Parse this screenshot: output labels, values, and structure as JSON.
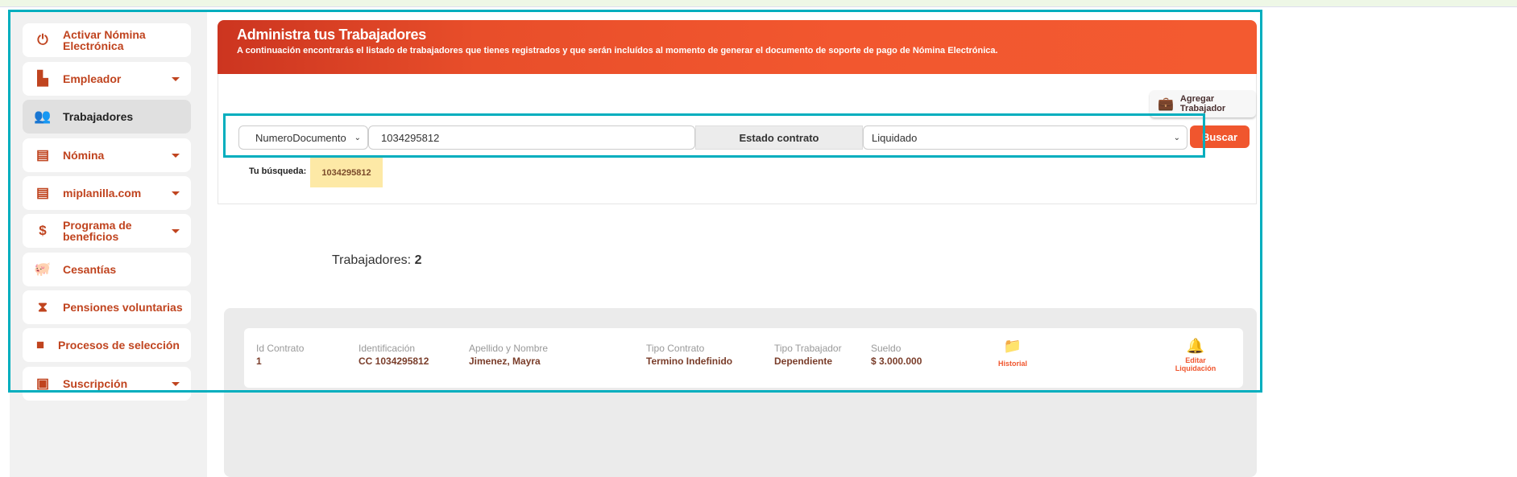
{
  "sidebar": {
    "items": [
      {
        "label": "Activar Nómina Electrónica",
        "icon": "power-icon",
        "dropdown": false,
        "active": false
      },
      {
        "label": "Empleador",
        "icon": "building-user-icon",
        "dropdown": true,
        "active": false
      },
      {
        "label": "Trabajadores",
        "icon": "users-icon",
        "dropdown": false,
        "active": true
      },
      {
        "label": "Nómina",
        "icon": "invoice-dollar-icon",
        "dropdown": true,
        "active": false
      },
      {
        "label": "miplanilla.com",
        "icon": "file-icon",
        "dropdown": true,
        "active": false
      },
      {
        "label": "Programa de beneficios",
        "icon": "dollar-icon",
        "dropdown": true,
        "active": false
      },
      {
        "label": "Cesantías",
        "icon": "piggy-bank-icon",
        "dropdown": false,
        "active": false
      },
      {
        "label": "Pensiones voluntarias",
        "icon": "hourglass-icon",
        "dropdown": false,
        "active": false
      },
      {
        "label": "Procesos de selección",
        "icon": "video-icon",
        "dropdown": false,
        "active": false
      },
      {
        "label": "Suscripción",
        "icon": "id-card-icon",
        "dropdown": true,
        "active": false
      }
    ]
  },
  "header": {
    "title": "Administra tus Trabajadores",
    "subtitle": "A continuación encontrarás el listado de trabajadores que tienes registrados y que serán incluídos al momento de generar el documento de soporte de pago de Nómina Electrónica."
  },
  "actions": {
    "add_worker": "Agregar Trabajador"
  },
  "search": {
    "field_select": "NumeroDocumento",
    "query": "1034295812",
    "estado_label": "Estado contrato",
    "estado_select": "Liquidado",
    "button": "Buscar",
    "your_search_label": "Tu búsqueda:",
    "chip": "1034295812"
  },
  "summary": {
    "label": "Trabajadores:",
    "count": "2"
  },
  "workers": [
    {
      "id_label": "Id Contrato",
      "id": "1",
      "ident_label": "Identificación",
      "ident": "CC 1034295812",
      "name_label": "Apellido y Nombre",
      "name": "Jimenez, Mayra",
      "tipo_contrato_label": "Tipo Contrato",
      "tipo_contrato": "Termino Indefinido",
      "tipo_trab_label": "Tipo Trabajador",
      "tipo_trab": "Dependiente",
      "sueldo_label": "Sueldo",
      "sueldo": "$ 3.000.000",
      "historial": "Historial",
      "editar": "Editar Liquidación"
    }
  ],
  "colors": {
    "accent": "#f0562e",
    "sidebar_text": "#c0441f",
    "highlight": "#00aebe"
  }
}
